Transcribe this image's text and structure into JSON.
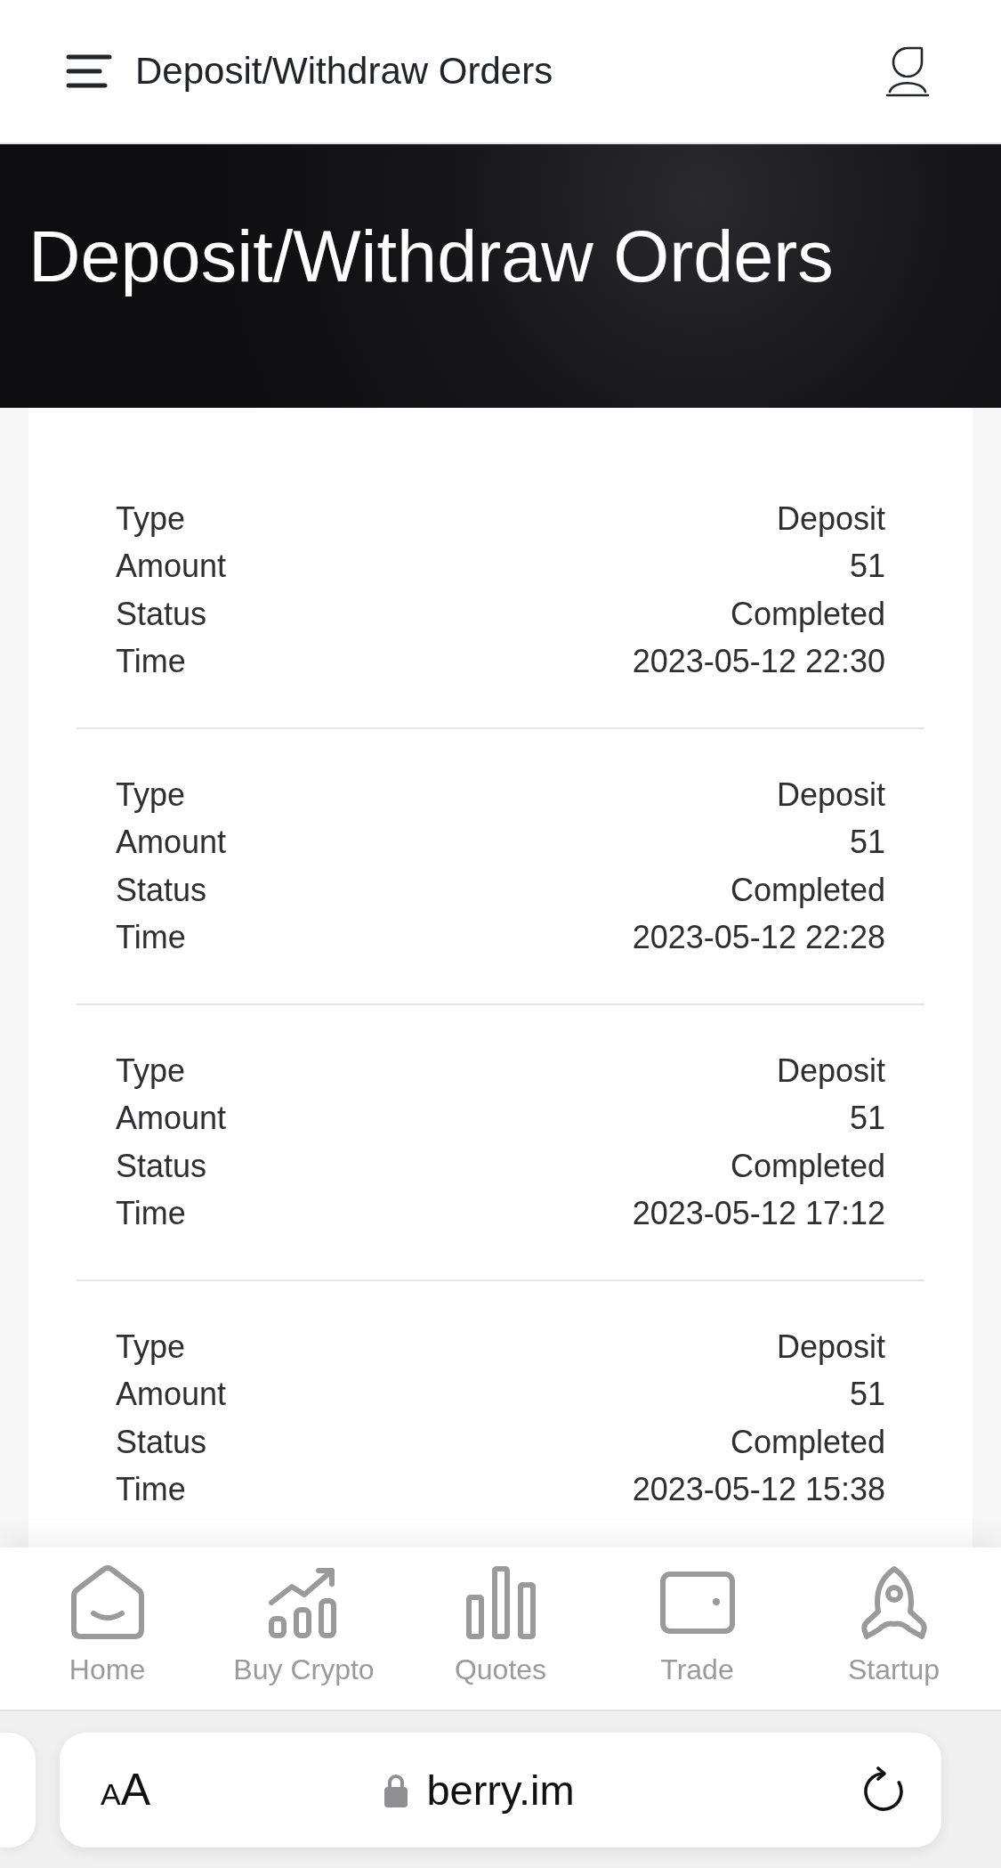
{
  "header": {
    "title": "Deposit/Withdraw Orders"
  },
  "banner": {
    "title": "Deposit/Withdraw Orders"
  },
  "orders": [
    {
      "fields": [
        {
          "label": "Type",
          "value": "Deposit"
        },
        {
          "label": "Amount",
          "value": "51"
        },
        {
          "label": "Status",
          "value": "Completed"
        },
        {
          "label": "Time",
          "value": "2023-05-12 22:30"
        }
      ]
    },
    {
      "fields": [
        {
          "label": "Type",
          "value": "Deposit"
        },
        {
          "label": "Amount",
          "value": "51"
        },
        {
          "label": "Status",
          "value": "Completed"
        },
        {
          "label": "Time",
          "value": "2023-05-12 22:28"
        }
      ]
    },
    {
      "fields": [
        {
          "label": "Type",
          "value": "Deposit"
        },
        {
          "label": "Amount",
          "value": "51"
        },
        {
          "label": "Status",
          "value": "Completed"
        },
        {
          "label": "Time",
          "value": "2023-05-12 17:12"
        }
      ]
    },
    {
      "fields": [
        {
          "label": "Type",
          "value": "Deposit"
        },
        {
          "label": "Amount",
          "value": "51"
        },
        {
          "label": "Status",
          "value": "Completed"
        },
        {
          "label": "Time",
          "value": "2023-05-12 15:38"
        }
      ]
    }
  ],
  "bottom_nav": [
    {
      "label": "Home",
      "selected": false
    },
    {
      "label": "Buy Crypto",
      "selected": false
    },
    {
      "label": "Quotes",
      "selected": false
    },
    {
      "label": "Trade",
      "selected": false
    },
    {
      "label": "Startup",
      "selected": false
    }
  ],
  "browser_bar": {
    "text_size_button": {
      "small": "A",
      "large": "A"
    },
    "url": "berry.im"
  }
}
